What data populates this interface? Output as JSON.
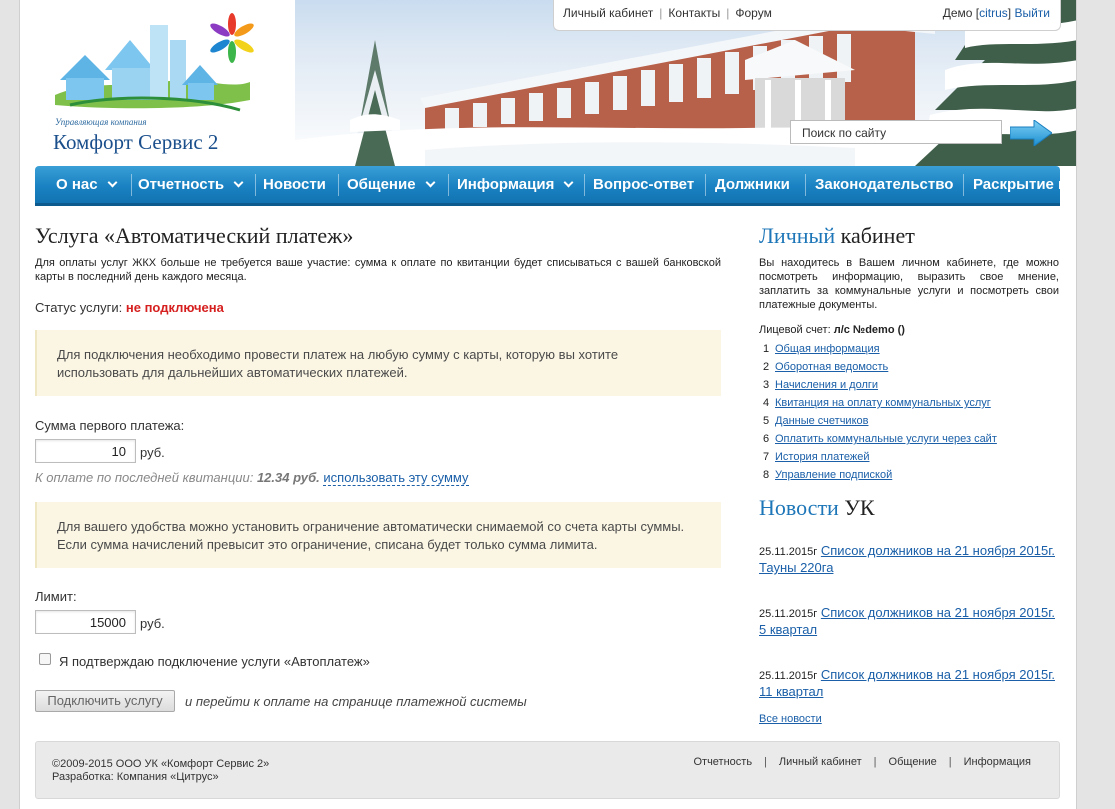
{
  "logo": {
    "tagline": "Управляющая компания",
    "name": "Комфорт Сервис 2"
  },
  "topnav": {
    "links": [
      "Личный кабинет",
      "Контакты",
      "Форум"
    ],
    "user": "Демо",
    "login": "citrus",
    "logout": "Выйти"
  },
  "search": {
    "placeholder": "Поиск по сайту"
  },
  "menu": {
    "items": [
      {
        "label": "О нас",
        "dropdown": true
      },
      {
        "label": "Отчетность",
        "dropdown": true
      },
      {
        "label": "Новости",
        "dropdown": false
      },
      {
        "label": "Общение",
        "dropdown": true
      },
      {
        "label": "Информация",
        "dropdown": true
      },
      {
        "label": "Вопрос-ответ",
        "dropdown": false
      },
      {
        "label": "Должники",
        "dropdown": false
      },
      {
        "label": "Законодательство",
        "dropdown": false
      },
      {
        "label": "Раскрытие и",
        "dropdown": false
      }
    ]
  },
  "main": {
    "title": "Услуга «Автоматический платеж»",
    "intro": "Для оплаты услуг ЖКХ больше не требуется ваше участие: сумма к оплате по квитанции будет списываться с вашей банковской карты в последний день каждого месяца.",
    "status_label": "Статус услуги:",
    "status_value": "не подключена",
    "notice1": "Для подключения необходимо провести платеж на любую сумму с карты, которую вы хотите использовать для дальнейших автоматических платежей.",
    "first_payment_label": "Сумма первого платежа:",
    "first_payment_value": "10",
    "currency": "руб.",
    "hint_prefix": "К оплате по последней квитанции:",
    "hint_amount": "12.34 руб.",
    "hint_link": "использовать эту сумму",
    "notice2": "Для вашего удобства можно установить ограничение автоматически снимаемой со счета карты суммы. Если сумма начислений превысит это ограничение, списана будет только сумма лимита.",
    "limit_label": "Лимит:",
    "limit_value": "15000",
    "confirm_label": "Я подтверждаю подключение услуги «Автоплатеж»",
    "submit_label": "Подключить услугу",
    "submit_note": "и перейти к оплате на странице платежной системы"
  },
  "sidebar": {
    "cabinet_title_highlight": "Личный",
    "cabinet_title_rest": "кабинет",
    "cabinet_intro": "Вы находитесь в Вашем личном кабинете, где можно посмотреть информацию, выразить свое мнение, заплатить за коммунальные услуги и посмотреть свои платежные документы.",
    "account_label": "Лицевой счет:",
    "account_value": "л/с №demo ()",
    "links": [
      {
        "num": "1",
        "label": "Общая информация"
      },
      {
        "num": "2",
        "label": "Оборотная ведомость"
      },
      {
        "num": "3",
        "label": "Начисления и долги"
      },
      {
        "num": "4",
        "label": "Квитанция на оплату коммунальных услуг"
      },
      {
        "num": "5",
        "label": "Данные счетчиков"
      },
      {
        "num": "6",
        "label": "Оплатить коммунальные услуги через сайт"
      },
      {
        "num": "7",
        "label": "История платежей"
      },
      {
        "num": "8",
        "label": "Управление подпиской"
      }
    ],
    "news_title_highlight": "Новости",
    "news_title_rest": "УК",
    "news": [
      {
        "date": "25.11.2015г",
        "title": "Список должников на 21 ноября 2015г. Тауны 220га"
      },
      {
        "date": "25.11.2015г",
        "title": "Список должников на 21 ноября 2015г. 5 квартал"
      },
      {
        "date": "25.11.2015г",
        "title": "Список должников на 21 ноября 2015г. 11 квартал"
      }
    ],
    "all_news": "Все новости"
  },
  "footer": {
    "copyright": "©2009-2015 ООО УК «Комфорт Сервис 2»",
    "developer": "Разработка: Компания «Цитрус»",
    "links": [
      "Отчетность",
      "Личный кабинет",
      "Общение",
      "Информация"
    ]
  }
}
